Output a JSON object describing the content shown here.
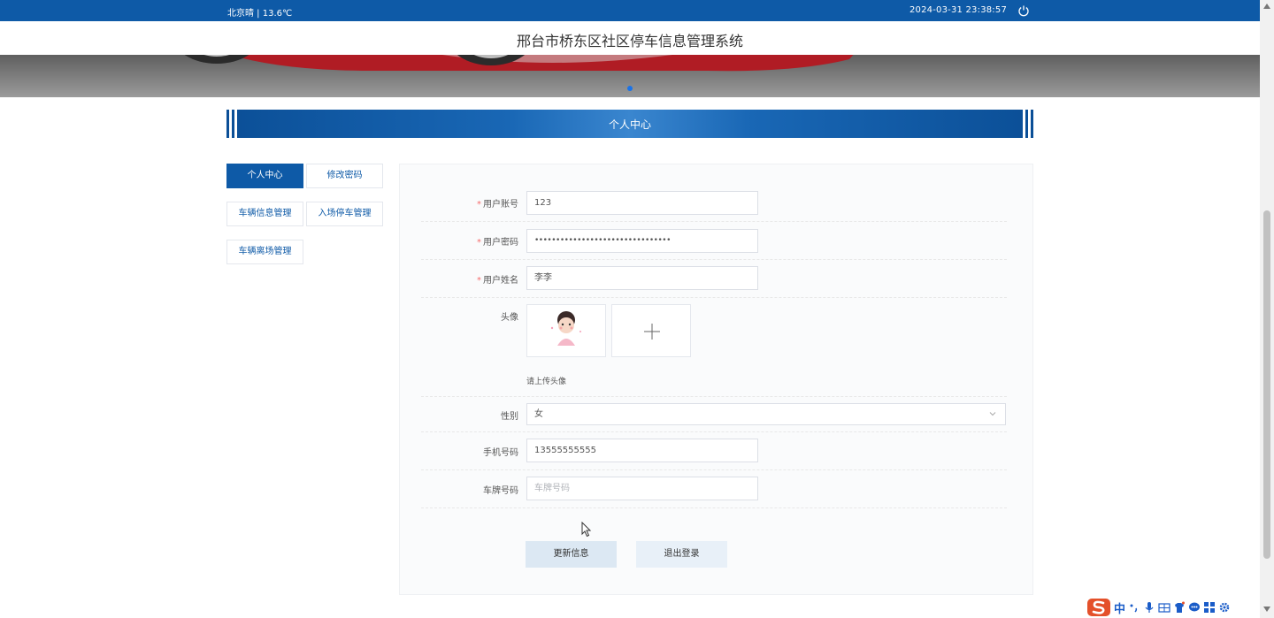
{
  "topbar": {
    "weather": "北京晴 | 13.6℃",
    "datetime": "2024-03-31   23:38:57"
  },
  "header": {
    "title": "邢台市桥东区社区停车信息管理系统"
  },
  "section": {
    "title": "个人中心"
  },
  "sidebar": {
    "items": [
      {
        "label": "个人中心",
        "active": true
      },
      {
        "label": "修改密码",
        "active": false
      },
      {
        "label": "车辆信息管理",
        "active": false
      },
      {
        "label": "入场停车管理",
        "active": false
      },
      {
        "label": "车辆离场管理",
        "active": false
      }
    ]
  },
  "form": {
    "account": {
      "label": "用户账号",
      "value": "123"
    },
    "password": {
      "label": "用户密码",
      "value": "••••••••••••••••••••••••••••••••"
    },
    "name": {
      "label": "用户姓名",
      "value": "李李"
    },
    "avatar": {
      "label": "头像",
      "hint": "请上传头像"
    },
    "gender": {
      "label": "性别",
      "value": "女"
    },
    "phone": {
      "label": "手机号码",
      "value": "13555555555"
    },
    "plate": {
      "label": "车牌号码",
      "placeholder": "车牌号码"
    },
    "required_mark": "*"
  },
  "actions": {
    "update": "更新信息",
    "logout": "退出登录"
  },
  "ime": {
    "text": "中"
  },
  "colors": {
    "primary": "#0e5aa7",
    "required": "#f56c6c"
  }
}
